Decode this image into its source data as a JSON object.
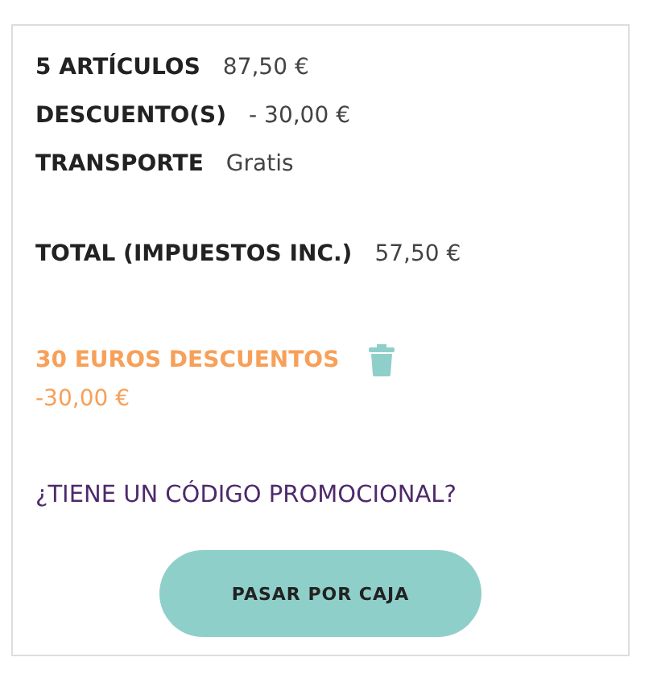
{
  "lines": [
    {
      "label": "5 ARTÍCULOS",
      "value": "87,50 €"
    },
    {
      "label": "DESCUENTO(S)",
      "value": "- 30,00 €"
    },
    {
      "label": "TRANSPORTE",
      "value": "Gratis"
    }
  ],
  "total": {
    "label": "TOTAL (IMPUESTOS INC.)",
    "value": "57,50 €"
  },
  "voucher": {
    "name": "30 EUROS DESCUENTOS",
    "amount": "-30,00 €"
  },
  "promo_link": "¿TIENE UN CÓDIGO PROMOCIONAL?",
  "checkout_button": "PASAR POR CAJA"
}
